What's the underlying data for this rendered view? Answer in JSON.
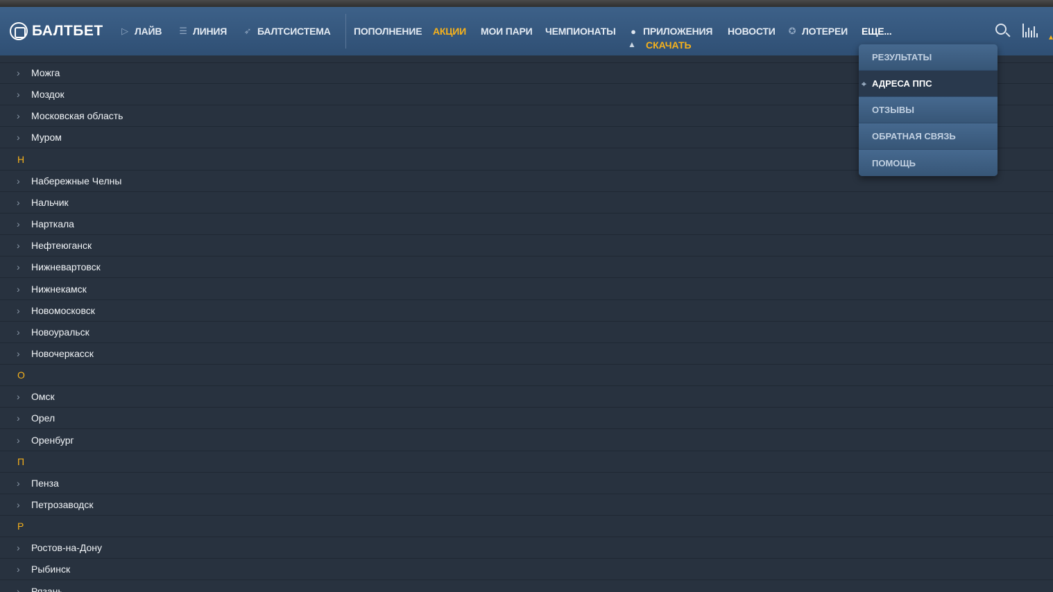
{
  "header": {
    "logo_text": "БАЛТБЕТ",
    "nav": {
      "live": "ЛАЙВ",
      "line": "ЛИНИЯ",
      "baltsystem": "БАЛТСИСТЕМА",
      "deposit": "ПОПОЛНЕНИЕ",
      "promotions": "АКЦИИ",
      "my_bets": "МОИ ПАРИ",
      "championships": "ЧЕМПИОНАТЫ",
      "apps": "ПРИЛОЖЕНИЯ",
      "apps_download": "СКАЧАТЬ",
      "news": "НОВОСТИ",
      "lotteries": "ЛОТЕРЕИ",
      "more": "ЕЩЕ..."
    },
    "accent_color": "#f7b21b"
  },
  "dropdown": {
    "items": [
      "РЕЗУЛЬТАТЫ",
      "АДРЕСА ППС",
      "ОТЗЫВЫ",
      "ОБРАТНАЯ СВЯЗЬ",
      "ПОМОЩЬ"
    ],
    "active": "АДРЕСА ППС"
  },
  "cities": {
    "rows": [
      {
        "type": "city",
        "name": "Можга"
      },
      {
        "type": "city",
        "name": "Моздок"
      },
      {
        "type": "city",
        "name": "Московская область"
      },
      {
        "type": "city",
        "name": "Муром"
      },
      {
        "type": "letter",
        "name": "Н"
      },
      {
        "type": "city",
        "name": "Набережные Челны"
      },
      {
        "type": "city",
        "name": "Нальчик"
      },
      {
        "type": "city",
        "name": "Нарткала"
      },
      {
        "type": "city",
        "name": "Нефтеюганск"
      },
      {
        "type": "city",
        "name": "Нижневартовск"
      },
      {
        "type": "city",
        "name": "Нижнекамск"
      },
      {
        "type": "city",
        "name": "Новомосковск"
      },
      {
        "type": "city",
        "name": "Новоуральск"
      },
      {
        "type": "city",
        "name": "Новочеркасск"
      },
      {
        "type": "letter",
        "name": "О"
      },
      {
        "type": "city",
        "name": "Омск"
      },
      {
        "type": "city",
        "name": "Орел"
      },
      {
        "type": "city",
        "name": "Оренбург"
      },
      {
        "type": "letter",
        "name": "П"
      },
      {
        "type": "city",
        "name": "Пенза"
      },
      {
        "type": "city",
        "name": "Петрозаводск"
      },
      {
        "type": "letter",
        "name": "Р"
      },
      {
        "type": "city",
        "name": "Ростов-на-Дону"
      },
      {
        "type": "city",
        "name": "Рыбинск"
      },
      {
        "type": "city",
        "name": "Рязань"
      }
    ]
  }
}
